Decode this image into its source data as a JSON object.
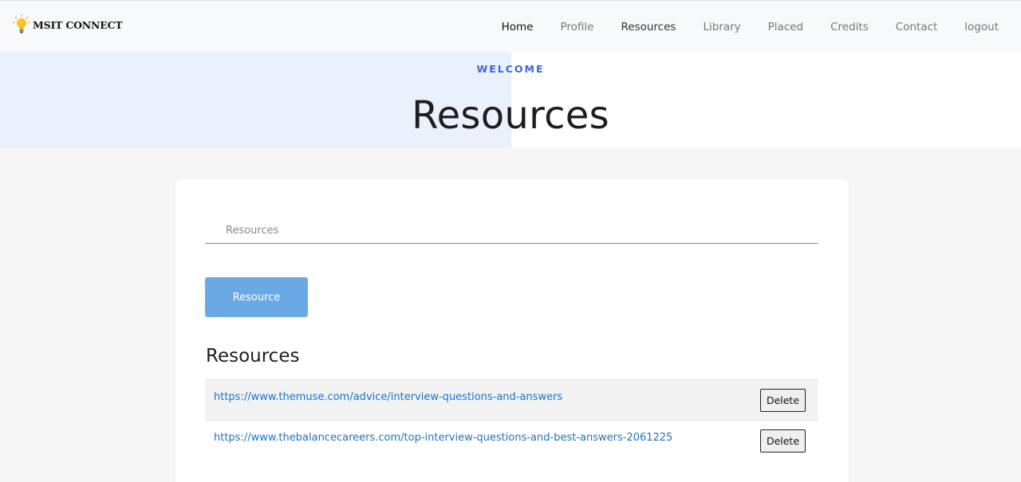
{
  "brand": {
    "name": "MSIT CONNECT",
    "logo_icon": "lightbulb-icon",
    "logo_color": "#f5b820"
  },
  "nav": [
    {
      "label": "Home",
      "name": "nav-home"
    },
    {
      "label": "Profile",
      "name": "nav-profile"
    },
    {
      "label": "Resources",
      "name": "nav-resources"
    },
    {
      "label": "Library",
      "name": "nav-library"
    },
    {
      "label": "Placed",
      "name": "nav-placed"
    },
    {
      "label": "Credits",
      "name": "nav-credits"
    },
    {
      "label": "Contact",
      "name": "nav-contact"
    },
    {
      "label": "logout",
      "name": "nav-logout"
    }
  ],
  "hero": {
    "eyebrow": "WELCOME",
    "title": "Resources"
  },
  "form": {
    "input_placeholder": "Resources",
    "input_value": "",
    "submit_label": "Resource"
  },
  "list": {
    "heading": "Resources",
    "rows": [
      {
        "url": "https://www.themuse.com/advice/interview-questions-and-answers",
        "delete_label": "Delete"
      },
      {
        "url": "https://www.thebalancecareers.com/top-interview-questions-and-best-answers-2061225",
        "delete_label": "Delete"
      }
    ]
  },
  "colors": {
    "accent": "#3b66e0",
    "button": "#6aa9e4",
    "link": "#1a73c8",
    "hero_tint": "#ebf0fd"
  }
}
